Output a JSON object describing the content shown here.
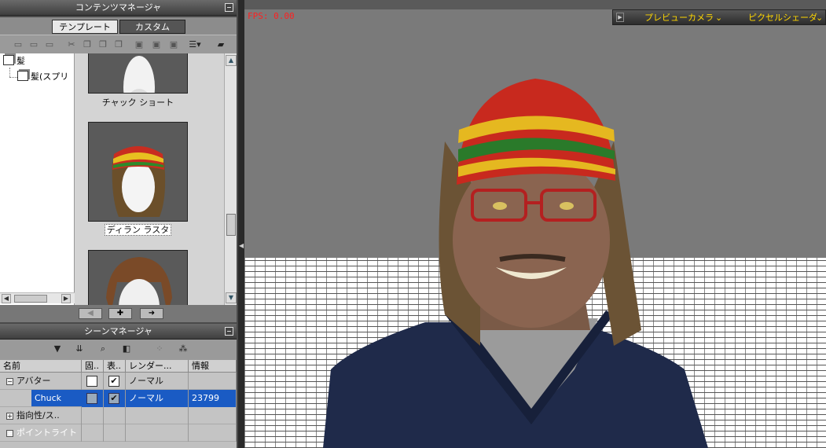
{
  "colors": {
    "fps": "#ff2020",
    "camera_text": "#ffd700",
    "selection": "#1a5bc4"
  },
  "content_manager": {
    "title": "コンテンツマネージャ",
    "tabs": [
      {
        "label": "テンプレート",
        "active": true
      },
      {
        "label": "カスタム",
        "active": false
      }
    ],
    "tree": [
      "髪",
      "髪(スプリ"
    ],
    "thumbnails": [
      {
        "caption": "チャック ショート",
        "icon": "white-head-short-hair"
      },
      {
        "caption": "ディラン ラスタ",
        "icon": "rasta-hat-dreadlocks",
        "selected": true
      },
      {
        "caption": "",
        "icon": "brown-hair"
      }
    ]
  },
  "scene_manager": {
    "title": "シーンマネージャ",
    "columns": [
      "名前",
      "固..",
      "表..",
      "レンダー...",
      "情報"
    ],
    "rows": [
      {
        "name": "アバター",
        "expand": "−",
        "fixed": false,
        "visible": true,
        "render": "ノーマル",
        "info": ""
      },
      {
        "name": "Chuck",
        "expand": "",
        "fixed": false,
        "visible": true,
        "render": "ノーマル",
        "info": "23799",
        "selected": true
      },
      {
        "name": "指向性/ス..",
        "expand": "+",
        "fixed": null,
        "visible": null,
        "render": "",
        "info": ""
      },
      {
        "name": "ポイントライト",
        "expand": "+",
        "fixed": null,
        "visible": null,
        "render": "",
        "info": ""
      }
    ]
  },
  "viewport": {
    "fps": "FPS: 0.00",
    "camera_menu": "プレビューカメラ",
    "shader_menu": "ピクセルシェーダ"
  }
}
